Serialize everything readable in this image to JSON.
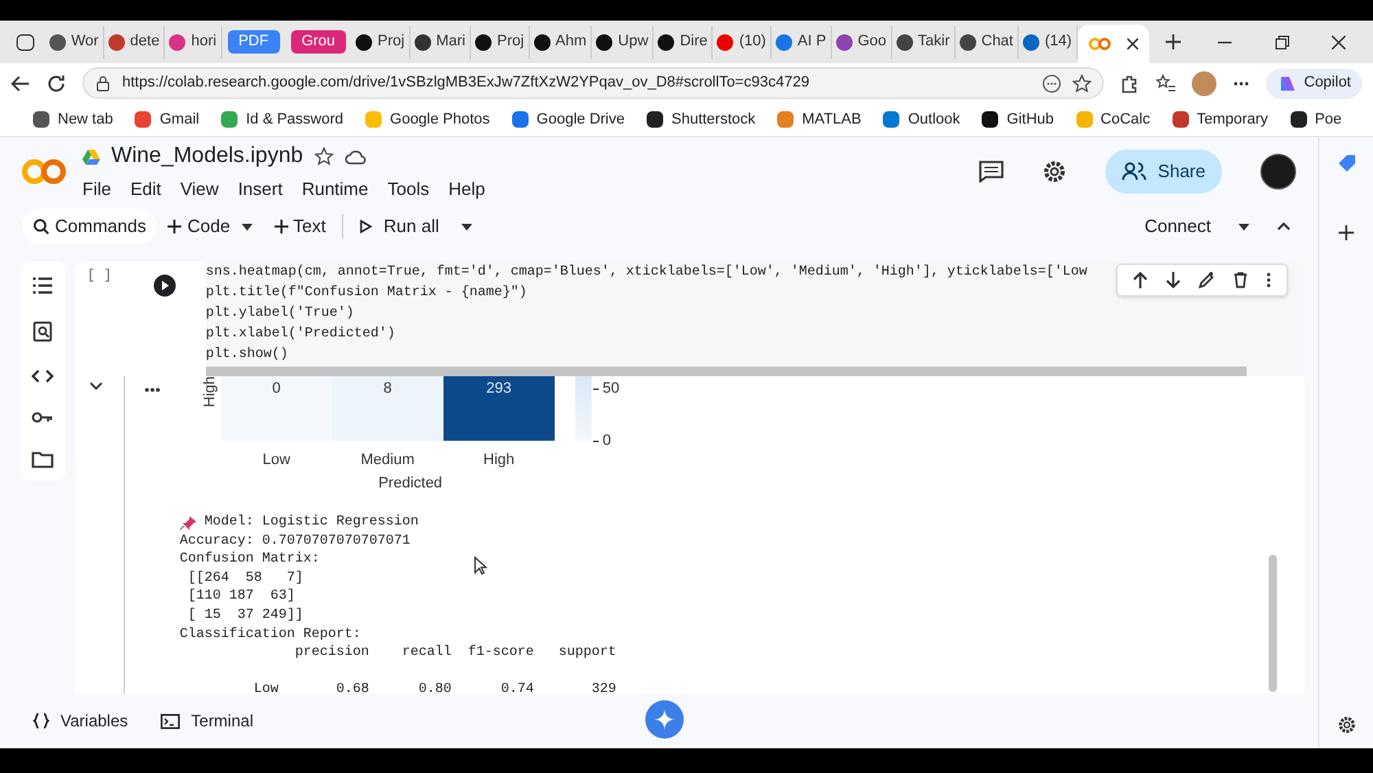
{
  "browser": {
    "tabs": [
      {
        "kind": "tab",
        "label": "Wor"
      },
      {
        "kind": "tab",
        "label": "dete"
      },
      {
        "kind": "tab",
        "label": "hori"
      },
      {
        "kind": "group",
        "label": "PDF",
        "color": "#3b82f6"
      },
      {
        "kind": "group",
        "label": "Grou",
        "color": "#db2777"
      },
      {
        "kind": "tab",
        "label": "Proj"
      },
      {
        "kind": "tab",
        "label": "Mari"
      },
      {
        "kind": "tab",
        "label": "Proj"
      },
      {
        "kind": "tab",
        "label": "Ahm"
      },
      {
        "kind": "tab",
        "label": "Upw"
      },
      {
        "kind": "tab",
        "label": "Dire"
      },
      {
        "kind": "tab",
        "label": "(10)"
      },
      {
        "kind": "tab",
        "label": "AI P"
      },
      {
        "kind": "tab",
        "label": "Goo"
      },
      {
        "kind": "tab",
        "label": "Takir"
      },
      {
        "kind": "tab",
        "label": "Chat"
      },
      {
        "kind": "tab",
        "label": "(14)"
      },
      {
        "kind": "active"
      }
    ],
    "address": "https://colab.research.google.com/drive/1vSBzlgMB3ExJw7ZftXzW2YPqav_ov_D8#scrollTo=c93c4729",
    "copilot": "Copilot",
    "bookmarks": [
      "New tab",
      "Gmail",
      "Id & Password",
      "Google Photos",
      "Google Drive",
      "Shutterstock",
      "MATLAB",
      "Outlook",
      "GitHub",
      "CoCalc",
      "Temporary",
      "Poe"
    ]
  },
  "notebook": {
    "title": "Wine_Models.ipynb",
    "menu": [
      "File",
      "Edit",
      "View",
      "Insert",
      "Runtime",
      "Tools",
      "Help"
    ],
    "share": "Share",
    "toolbar": {
      "commands": "Commands",
      "code": "Code",
      "text": "Text",
      "run_all": "Run all",
      "connect": "Connect"
    }
  },
  "cell": {
    "bracket": "[ ]",
    "code": [
      "sns.heatmap(cm, annot=True, fmt='d', cmap='Blues', xticklabels=['Low', 'Medium', 'High'], yticklabels=['Low",
      "plt.title(f\"Confusion Matrix - {name}\")",
      "plt.ylabel('True')",
      "plt.xlabel('Predicted')",
      "plt.show()"
    ]
  },
  "output": {
    "heatmap": {
      "ylabel": "High",
      "cells": [
        {
          "value": "0",
          "color": "#f4f8fd"
        },
        {
          "value": "8",
          "color": "#eef4fb"
        },
        {
          "value": "293",
          "color": "#0d4a8c"
        }
      ],
      "xticks": [
        "Low",
        "Medium",
        "High"
      ],
      "xlabel": "Predicted",
      "colorbar_ticks": [
        "50",
        "0"
      ]
    },
    "lines": [
      {
        "kind": "pinned",
        "text": "Model: Logistic Regression"
      },
      {
        "kind": "plain",
        "text": "Accuracy: 0.7070707070707071"
      },
      {
        "kind": "plain",
        "text": "Confusion Matrix:"
      },
      {
        "kind": "plain",
        "text": " [[264  58   7]"
      },
      {
        "kind": "plain",
        "text": " [110 187  63]"
      },
      {
        "kind": "plain",
        "text": " [ 15  37 249]]"
      },
      {
        "kind": "plain",
        "text": "Classification Report:"
      },
      {
        "kind": "plain",
        "text": "              precision    recall  f1-score   support"
      },
      {
        "kind": "gap",
        "text": "         Low       0.68      0.80      0.74       329"
      }
    ]
  },
  "bottom": [
    "Variables",
    "Terminal"
  ]
}
